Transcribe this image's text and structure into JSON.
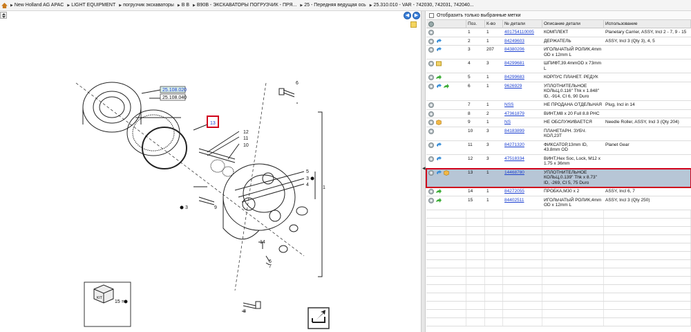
{
  "breadcrumb": [
    "New Holland AG APAC",
    "LIGHT EQUIPMENT",
    "погрузчик экскаваторы",
    "B B",
    "B90B - ЭКСКАВАТОРЫ ПОГРУЗЧИК - ПРЯ...",
    "25 - Передняя ведущая ось",
    "25.310.010 - VAR - 742030, 742031, 742040..."
  ],
  "filter_label": "Отобразить только выбранные метки",
  "columns": [
    "Поз.",
    "К-во",
    "№ детали",
    "Описание детали",
    "Использование"
  ],
  "diagram": {
    "callout_top": "25.108.020",
    "callout_bottom": "25.108.040",
    "selected_label": "13",
    "kit_label": "15 ="
  },
  "rows": [
    {
      "pos": "1",
      "qty": "1",
      "pn": "401754110005",
      "desc": "КОМПЛЕКТ",
      "use": "Planetary Carrier, ASSY, Incl 2 - 7, 9 - 15",
      "icons": [
        "info"
      ]
    },
    {
      "pos": "2",
      "qty": "1",
      "pn": "84249603",
      "desc": "ДЕРЖАТЕЛЬ",
      "use": "ASSY, Incl 3 (Qty 3), 4, 5",
      "icons": [
        "info",
        "replace"
      ]
    },
    {
      "pos": "3",
      "qty": "207",
      "pn": "84380206",
      "desc": "ИГОЛЬЧАТЫЙ РОЛИК,4mm OD x 12mm L",
      "use": "",
      "icons": [
        "info",
        "replace"
      ]
    },
    {
      "pos": "4",
      "qty": "3",
      "pn": "84299681",
      "desc": "ШПИФТ,39.4mmOD x 73mm L",
      "use": "",
      "icons": [
        "info",
        "note"
      ]
    },
    {
      "pos": "5",
      "qty": "1",
      "pn": "84299683",
      "desc": "КОРПУС ПЛАНЕТ. РЕДУК",
      "use": "",
      "icons": [
        "info",
        "green"
      ]
    },
    {
      "pos": "6",
      "qty": "1",
      "pn": "9626929",
      "desc": "УПЛОТНИТЕЛЬНОЕ КОЛЬЦ,0.116\" Thk x 1.848\" ID, -914, CI 6, 90 Duro",
      "use": "",
      "icons": [
        "info",
        "replace",
        "green"
      ]
    },
    {
      "pos": "7",
      "qty": "1",
      "pn": "NSS",
      "desc": "НЕ ПРОДАНА ОТДЕЛЬНАЯ",
      "use": "Plug, Incl in 14",
      "icons": [
        "info"
      ]
    },
    {
      "pos": "8",
      "qty": "2",
      "pn": "47361879",
      "desc": "ВИНТ,M8 x 20 Full 8.8 PHC",
      "use": "",
      "icons": [
        "info"
      ]
    },
    {
      "pos": "9",
      "qty": "1",
      "pn": "NS",
      "desc": "НЕ ОБСЛУЖИВАЕТСЯ",
      "use": "Needle Roller, ASSY, Incl 3 (Qty 204)",
      "icons": [
        "info",
        "cube"
      ]
    },
    {
      "pos": "10",
      "qty": "3",
      "pn": "84183899",
      "desc": "ПЛАНЕТАРН. ЗУБЧ. КОЛ,23T",
      "use": "",
      "icons": [
        "info"
      ]
    },
    {
      "pos": "11",
      "qty": "3",
      "pn": "84271320",
      "desc": "ФИКСАТОР,13mm ID, 43.8mm OD",
      "use": "Planet Gear",
      "icons": [
        "info",
        "replace"
      ]
    },
    {
      "pos": "12",
      "qty": "3",
      "pn": "47518334",
      "desc": "ВИНТ,Hex Soc, Lock, M12 x 1.75 x 36mm",
      "use": "",
      "icons": [
        "info",
        "replace"
      ]
    },
    {
      "pos": "13",
      "qty": "1",
      "pn": "14468780",
      "desc": "УПЛОТНИТЕЛЬНОЕ КОЛЬЦ,0.139\" Thk x 8.73\" ID, -269, CI 5, 75 Duro",
      "use": "",
      "icons": [
        "info",
        "replace",
        "cube"
      ],
      "selected": true
    },
    {
      "pos": "14",
      "qty": "1",
      "pn": "84272055",
      "desc": "ПРОБКА,M30 x 2",
      "use": "ASSY, Incl 6, 7",
      "icons": [
        "info",
        "green"
      ]
    },
    {
      "pos": "15",
      "qty": "1",
      "pn": "84402511",
      "desc": "ИГОЛЬЧАТЫЙ РОЛИК,4mm OD x 12mm L",
      "use": "ASSY, Incl 3 (Qty 250)",
      "icons": [
        "info",
        "green"
      ]
    }
  ]
}
